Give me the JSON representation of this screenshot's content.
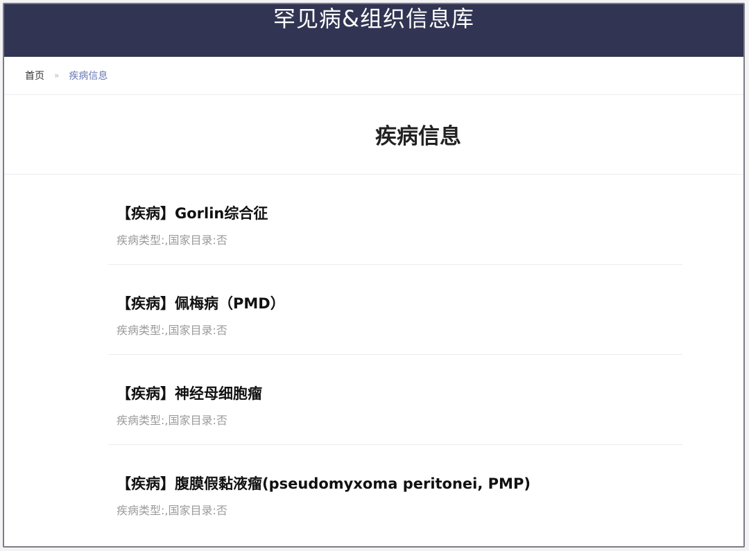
{
  "header": {
    "title": "罕见病&组织信息库"
  },
  "breadcrumb": {
    "home": "首页",
    "separator": "»",
    "current": "疾病信息"
  },
  "page": {
    "title": "疾病信息"
  },
  "items": [
    {
      "title": "【疾病】Gorlin综合征",
      "meta": "疾病类型:,国家目录:否"
    },
    {
      "title": "【疾病】佩梅病（PMD）",
      "meta": "疾病类型:,国家目录:否"
    },
    {
      "title": "【疾病】神经母细胞瘤",
      "meta": "疾病类型:,国家目录:否"
    },
    {
      "title": "【疾病】腹膜假黏液瘤(pseudomyxoma peritonei, PMP)",
      "meta": "疾病类型:,国家目录:否"
    }
  ],
  "colors": {
    "header_bg": "#313553",
    "link_accent": "#6a7ab6"
  }
}
